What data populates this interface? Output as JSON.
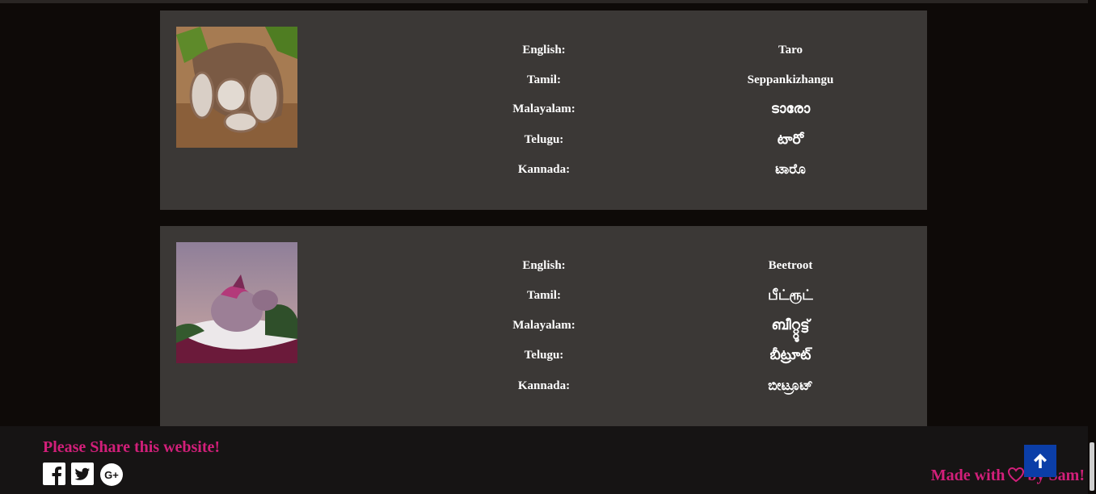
{
  "items": [
    {
      "image": "taro-root-photo",
      "rows": [
        {
          "label": "English:",
          "value": "Taro"
        },
        {
          "label": "Tamil:",
          "value": "Seppankizhangu"
        },
        {
          "label": "Malayalam:",
          "value": "ടാരോ"
        },
        {
          "label": "Telugu:",
          "value": "టారో"
        },
        {
          "label": "Kannada:",
          "value": "ಟಾರೊ"
        }
      ]
    },
    {
      "image": "beetroot-photo",
      "rows": [
        {
          "label": "English:",
          "value": "Beetroot"
        },
        {
          "label": "Tamil:",
          "value": "பீட்ரூட்"
        },
        {
          "label": "Malayalam:",
          "value": "ബീറ്റ്റൂട്ട്"
        },
        {
          "label": "Telugu:",
          "value": "బీట్రూట్"
        },
        {
          "label": "Kannada:",
          "value": "ಬೀಟ್ರೂಟ್"
        }
      ]
    }
  ],
  "footer": {
    "share_title": "Please Share this website!",
    "social_icons": [
      "facebook-icon",
      "twitter-icon",
      "google-plus-icon"
    ],
    "made_with_prefix": "Made with",
    "made_with_suffix": "by Sam!",
    "accent_color": "#d21f7a",
    "back_to_top_icon": "arrow-up-icon",
    "back_to_top_color": "#0b3ea8"
  }
}
